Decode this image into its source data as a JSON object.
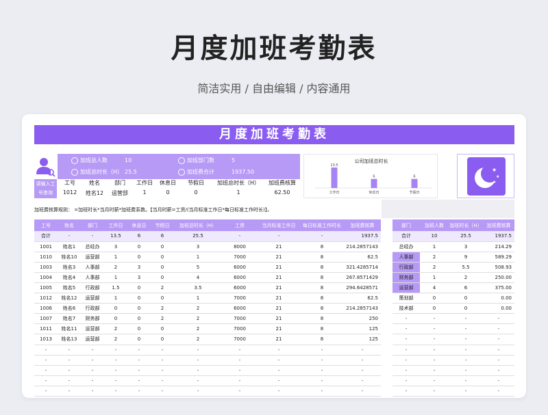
{
  "hero": {
    "title": "月度加班考勤表",
    "subtitle": "简洁实用 / 自由编辑 / 内容通用"
  },
  "banner": "月度加班考勤表",
  "query_label": "请输入工号查询",
  "stats": {
    "total_people_label": "加班总人数",
    "total_people": "10",
    "dept_count_label": "加班部门数",
    "dept_count": "5",
    "total_hours_label": "加班总时长（H）",
    "total_hours": "25.5",
    "total_fee_label": "加班费合计",
    "total_fee": "1937.50"
  },
  "lookup": {
    "headers": [
      "工号",
      "姓名",
      "部门",
      "工作日",
      "休息日",
      "节假日",
      "加班总时长（H）",
      "加班费核算"
    ],
    "values": [
      "1012",
      "姓名12",
      "运营部",
      "1",
      "0",
      "0",
      "1",
      "62.50"
    ]
  },
  "chart_data": {
    "type": "bar",
    "title": "公司加班总时长",
    "categories": [
      "工作日",
      "休息日",
      "节假日"
    ],
    "values": [
      13.5,
      6,
      6
    ],
    "data_labels": [
      "13.5",
      "6",
      "6"
    ]
  },
  "formula": "加班费核算规则： =加班时长*当月时薪*加班费系数。【当月时薪=工资/(当月标准工作日*每日标准工作时长)】。",
  "main_table": {
    "headers": [
      "工号",
      "姓名",
      "部门",
      "工作日",
      "休息日",
      "节假日",
      "加班总时长（H）",
      "工资",
      "当月标准工作日",
      "每日标准工作时长",
      "加班费核算"
    ],
    "rows": [
      [
        "合计",
        "-",
        "-",
        "13.5",
        "6",
        "6",
        "25.5",
        "-",
        "-",
        "-",
        "1937.5"
      ],
      [
        "1001",
        "姓名1",
        "总经办",
        "3",
        "0",
        "0",
        "3",
        "8000",
        "21",
        "8",
        "214.2857143"
      ],
      [
        "1010",
        "姓名10",
        "运营部",
        "1",
        "0",
        "0",
        "1",
        "7000",
        "21",
        "8",
        "62.5"
      ],
      [
        "1003",
        "姓名3",
        "人事部",
        "2",
        "3",
        "0",
        "5",
        "6000",
        "21",
        "8",
        "321.4285714"
      ],
      [
        "1004",
        "姓名4",
        "人事部",
        "1",
        "3",
        "0",
        "4",
        "6000",
        "21",
        "8",
        "267.8571429"
      ],
      [
        "1005",
        "姓名5",
        "行政部",
        "1.5",
        "0",
        "2",
        "3.5",
        "6000",
        "21",
        "8",
        "294.6428571"
      ],
      [
        "1012",
        "姓名12",
        "运营部",
        "1",
        "0",
        "0",
        "1",
        "7000",
        "21",
        "8",
        "62.5"
      ],
      [
        "1006",
        "姓名6",
        "行政部",
        "0",
        "0",
        "2",
        "2",
        "6000",
        "21",
        "8",
        "214.2857143"
      ],
      [
        "1007",
        "姓名7",
        "财务部",
        "0",
        "0",
        "2",
        "2",
        "7000",
        "21",
        "8",
        "250"
      ],
      [
        "1011",
        "姓名11",
        "运营部",
        "2",
        "0",
        "0",
        "2",
        "7000",
        "21",
        "8",
        "125"
      ],
      [
        "1013",
        "姓名13",
        "运营部",
        "2",
        "0",
        "0",
        "2",
        "7000",
        "21",
        "8",
        "125"
      ],
      [
        "-",
        "-",
        "-",
        "-",
        "-",
        "-",
        "-",
        "-",
        "-",
        "-",
        "-"
      ],
      [
        "-",
        "-",
        "-",
        "-",
        "-",
        "-",
        "-",
        "-",
        "-",
        "-",
        "-"
      ],
      [
        "-",
        "-",
        "-",
        "-",
        "-",
        "-",
        "-",
        "-",
        "-",
        "-",
        "-"
      ],
      [
        "-",
        "-",
        "-",
        "-",
        "-",
        "-",
        "-",
        "-",
        "-",
        "-",
        "-"
      ],
      [
        "-",
        "-",
        "-",
        "-",
        "-",
        "-",
        "-",
        "-",
        "-",
        "-",
        "-"
      ]
    ]
  },
  "side_table": {
    "headers": [
      "部门",
      "加班人数",
      "加班时长（H）",
      "加班费核算"
    ],
    "rows": [
      [
        "合计",
        "10",
        "25.5",
        "1937.5"
      ],
      [
        "总经办",
        "1",
        "3",
        "214.29"
      ],
      [
        "人事部",
        "2",
        "9",
        "589.29"
      ],
      [
        "行政部",
        "2",
        "5.5",
        "508.93"
      ],
      [
        "财务部",
        "1",
        "2",
        "250.00"
      ],
      [
        "运营部",
        "4",
        "6",
        "375.00"
      ],
      [
        "策划部",
        "0",
        "0",
        "0.00"
      ],
      [
        "技术部",
        "0",
        "0",
        "0.00"
      ],
      [
        "-",
        "-",
        "-",
        "-"
      ],
      [
        "-",
        "-",
        "-",
        "-"
      ],
      [
        "-",
        "-",
        "-",
        "-"
      ],
      [
        "-",
        "-",
        "-",
        "-"
      ],
      [
        "-",
        "-",
        "-",
        "-"
      ],
      [
        "-",
        "-",
        "-",
        "-"
      ],
      [
        "-",
        "-",
        "-",
        "-"
      ],
      [
        "-",
        "-",
        "-",
        "-"
      ]
    ],
    "highlight_rows": [
      2,
      3,
      4,
      5
    ]
  },
  "colors": {
    "accent": "#8a5df0",
    "accent_light": "#b79af5",
    "stripe": "#eee9fd"
  }
}
